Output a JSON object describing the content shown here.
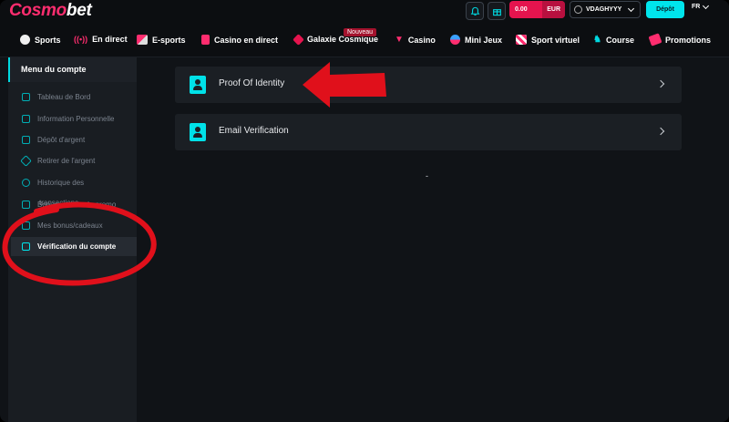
{
  "brand": {
    "logo_part1": "Cosmo",
    "logo_part2": "bet"
  },
  "header": {
    "balance_amount": "0.00",
    "balance_currency": "EUR",
    "username": "VDAGHYYY",
    "deposit_label": "Dépôt",
    "language": "FR",
    "notification_icon": "bell-icon",
    "gift_icon": "gift-icon"
  },
  "nav": {
    "badge": "Nouveau",
    "items": [
      {
        "label": "Sports",
        "icon": "ball-icon"
      },
      {
        "label": "En direct",
        "icon": "live-icon"
      },
      {
        "label": "E-sports",
        "icon": "controller-icon"
      },
      {
        "label": "Casino en direct",
        "icon": "cards-icon"
      },
      {
        "label": "Galaxie Cosmique",
        "icon": "rocket-icon"
      },
      {
        "label": "Casino",
        "icon": "cocktail-icon"
      },
      {
        "label": "Mini Jeux",
        "icon": "slot-icon"
      },
      {
        "label": "Sport virtuel",
        "icon": "flag-icon"
      },
      {
        "label": "Course",
        "icon": "horse-icon"
      },
      {
        "label": "Promotions",
        "icon": "ticket-icon"
      }
    ]
  },
  "sidebar": {
    "title": "Menu du compte",
    "items": [
      {
        "label": "Tableau de Bord",
        "icon": "dashboard-icon"
      },
      {
        "label": "Information Personnelle",
        "icon": "id-card-icon"
      },
      {
        "label": "Dépôt d'argent",
        "icon": "card-icon"
      },
      {
        "label": "Retirer de l'argent",
        "icon": "withdraw-icon"
      },
      {
        "label": "Historique des",
        "icon": "history-icon"
      },
      {
        "label": "Bonus avec code promo",
        "icon": "gift-icon"
      },
      {
        "label": "Mes bonus/cadeaux",
        "icon": "present-icon"
      },
      {
        "label": "Vérification du compte",
        "icon": "check-square-icon"
      }
    ],
    "overlap_text": "transactions"
  },
  "main": {
    "cards": [
      {
        "label": "Proof Of Identity",
        "icon": "id-badge-icon"
      },
      {
        "label": "Email Verification",
        "icon": "id-badge-icon"
      }
    ],
    "placeholder": "-"
  },
  "annotations": {
    "color": "#e0101b"
  }
}
